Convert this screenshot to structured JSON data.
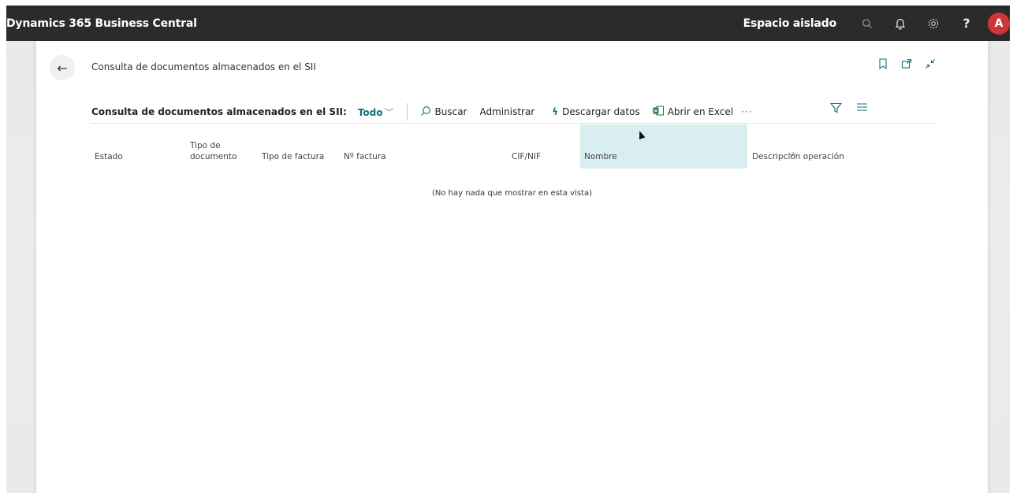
{
  "app": {
    "title": "Dynamics 365 Business Central",
    "environment": "Espacio aislado",
    "avatar_initial": "A"
  },
  "topbar_icons": [
    "search-icon",
    "bell-icon",
    "gear-icon",
    "help-icon"
  ],
  "page": {
    "title": "Consulta de documentos almacenados en el SII"
  },
  "header_icons": [
    "bookmark-icon",
    "open-new-window-icon",
    "collapse-icon"
  ],
  "command_bar": {
    "view_title": "Consulta de documentos almacenados en el SII:",
    "view_selector": "Todo",
    "search": "Buscar",
    "manage": "Administrar",
    "download": "Descargar datos",
    "open_excel": "Abrir en Excel",
    "more": "···"
  },
  "grid": {
    "columns": [
      "Estado",
      "Tipo de\ndocumento",
      "Tipo de factura",
      "Nº factura",
      "CIF/NIF",
      "Nombre",
      "Descripción operación"
    ],
    "empty_message": "(No hay nada que mostrar en esta vista)"
  },
  "colors": {
    "accent": "#0f6f7a",
    "topbar": "#2b2b2b",
    "avatar": "#d13438",
    "highlight": "#d9eef0"
  }
}
